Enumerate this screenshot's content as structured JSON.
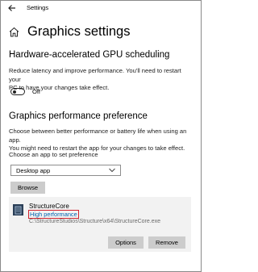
{
  "window": {
    "title": "Settings"
  },
  "page": {
    "title": "Graphics settings"
  },
  "gpu_scheduling": {
    "heading": "Hardware-accelerated GPU scheduling",
    "desc_line1": "Reduce latency and improve performance. You'll need to restart your",
    "desc_line2": "PC to have your changes take effect.",
    "toggle_label": "Off"
  },
  "preference": {
    "heading": "Graphics performance preference",
    "desc_line1": "Choose between better performance or battery life when using an app.",
    "desc_line2": "You might need to restart the app for your changes to take effect.",
    "choose_label": "Choose an app to set preference",
    "selected_app_type": "Desktop app",
    "browse_label": "Browse"
  },
  "app": {
    "name": "StructureCore",
    "preference": "High performance",
    "path": "C:\\StructureStudios\\Structure\\x64\\StructureCore.exe",
    "options_label": "Options",
    "remove_label": "Remove"
  },
  "colors": {
    "link": "#0063b1",
    "highlight_border": "#d0212d",
    "button_bg": "#cccccc",
    "card_bg": "#f2f2f2"
  }
}
